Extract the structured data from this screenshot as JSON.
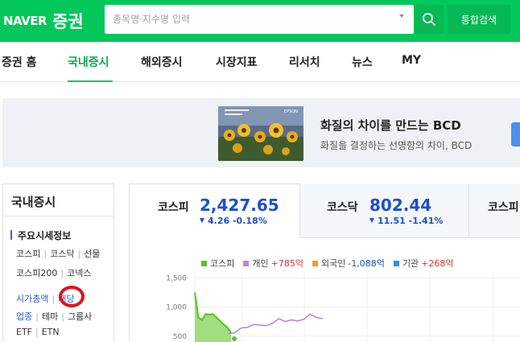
{
  "header": {
    "logo_naver": "NAVER",
    "logo_stock": "증권",
    "search_placeholder": "종목명·지수명 입력",
    "total_search_label": "통합검색",
    "brand_color": "#03c75a"
  },
  "nav": {
    "items": [
      "증권 홈",
      "국내증시",
      "해외증시",
      "시장지표",
      "리서치",
      "뉴스",
      "MY"
    ],
    "active": "국내증시"
  },
  "banner": {
    "title": "화질의 차이를 만드는 BCD",
    "subtitle": "화질을 결정하는 선명함의 차이, BCD",
    "image_brand": "EPSON"
  },
  "sidebar": {
    "title": "국내증시",
    "section": "주요시세정보",
    "row1": [
      "코스피",
      "코스닥",
      "선물"
    ],
    "row2": [
      "코스피200",
      "코넥스"
    ],
    "row3": [
      "시가총액",
      "배당"
    ],
    "row4": [
      "업종",
      "테마",
      "그룹사"
    ],
    "row5": [
      "ETF",
      "ETN"
    ]
  },
  "indices": [
    {
      "name": "코스피",
      "value": "2,427.65",
      "change": "4.26",
      "pct": "-0.18%"
    },
    {
      "name": "코스닥",
      "value": "802.44",
      "change": "11.51",
      "pct": "-1.41%"
    },
    {
      "name": "코스피"
    }
  ],
  "legend": [
    {
      "label": "코스피",
      "value": "",
      "color": "#52c41a"
    },
    {
      "label": "개인",
      "value": "+785억",
      "color": "#b486e6"
    },
    {
      "label": "외국인",
      "value": "-1,088억",
      "color": "#f39b2b"
    },
    {
      "label": "기관",
      "value": "+268억",
      "color": "#2e8de8"
    }
  ],
  "chart_data": {
    "type": "area",
    "y_ticks": [
      "1,500",
      "1,000",
      "500"
    ],
    "ylim": [
      400,
      1600
    ],
    "series": [
      {
        "name": "코스피",
        "color": "#52c41a",
        "values": [
          1250,
          820,
          780,
          880,
          870,
          880,
          820,
          760,
          700,
          650,
          560
        ]
      },
      {
        "name": "개인",
        "color": "#b486e6",
        "values": [
          540,
          560,
          640,
          650,
          700,
          690,
          680,
          720,
          800,
          750,
          780,
          760,
          790,
          880,
          820,
          800
        ]
      }
    ]
  }
}
